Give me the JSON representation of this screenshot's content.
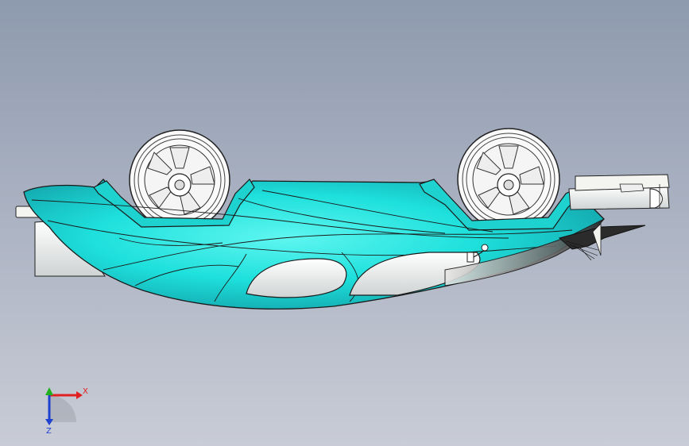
{
  "viewport": {
    "background_top": "#8e9aae",
    "background_bottom": "#c9ccd6"
  },
  "model": {
    "body_color": "#1ee0dc",
    "body_shadow": "#17b7bc",
    "trim_color": "#f2f2ee",
    "edge_color": "#1a1a1a"
  },
  "triad": {
    "x_label": "X",
    "z_label": "Z",
    "x_color": "#e02020",
    "y_color": "#20b020",
    "z_color": "#2040d0"
  }
}
